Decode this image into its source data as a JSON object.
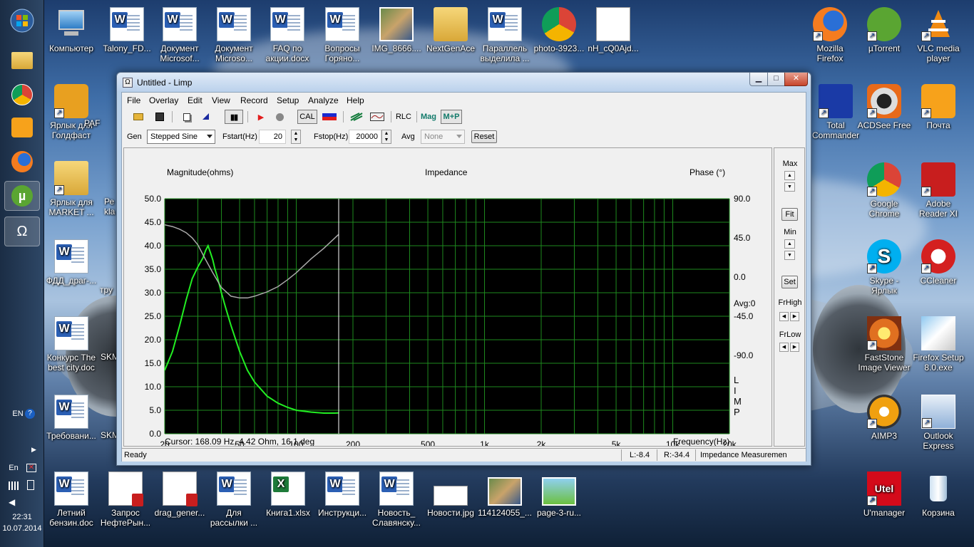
{
  "desktop": {
    "top_row": [
      {
        "label": "Компьютер",
        "kind": "computer"
      },
      {
        "label": "Talony_FD...",
        "kind": "doc"
      },
      {
        "label": "Документ Microsof...",
        "kind": "doc"
      },
      {
        "label": "Документ Microso...",
        "kind": "doc"
      },
      {
        "label": "FAQ по акции.docx",
        "kind": "doc"
      },
      {
        "label": "Вопросы Горяно...",
        "kind": "doc"
      },
      {
        "label": "IMG_8666....",
        "kind": "img"
      },
      {
        "label": "NextGenAce",
        "kind": "folder"
      },
      {
        "label": "Параллель выделила ...",
        "kind": "doc"
      },
      {
        "label": "photo-3923...",
        "kind": "chrome"
      },
      {
        "label": "nH_cQ0Ajd...",
        "kind": "img"
      }
    ],
    "left_col": [
      {
        "label": "Ярлык для Голдфаст"
      },
      {
        "label": "PAF"
      },
      {
        "label": "Ярлык для MARKET ..."
      },
      {
        "label": "Ре kla"
      },
      {
        "label": "ФДД_драг-..."
      },
      {
        "label": "тру"
      },
      {
        "label": "Конкурс The best city.doc"
      },
      {
        "label": "SKM"
      },
      {
        "label": "Требовани..."
      },
      {
        "label": "SKM"
      }
    ],
    "right_col": [
      {
        "label": "Mozilla Firefox"
      },
      {
        "label": "µTorrent"
      },
      {
        "label": "VLC media player"
      },
      {
        "label": "Total Commander"
      },
      {
        "label": "ACDSee Free"
      },
      {
        "label": "Почта"
      },
      {
        "label": "Google Chrome"
      },
      {
        "label": "Adobe Reader XI"
      },
      {
        "label": "Skype - Ярлык"
      },
      {
        "label": "CCleaner"
      },
      {
        "label": "FastStone Image Viewer"
      },
      {
        "label": "Firefox Setup 8.0.exe"
      },
      {
        "label": "AIMP3"
      },
      {
        "label": "Outlook Express"
      },
      {
        "label": "U'manager"
      },
      {
        "label": "Корзина"
      }
    ],
    "bottom_row": [
      {
        "label": "Летний бензин.doc"
      },
      {
        "label": "Запрос НефтеРын..."
      },
      {
        "label": "drag_gener..."
      },
      {
        "label": "Для рассылки ..."
      },
      {
        "label": "Книга1.xlsx"
      },
      {
        "label": "Инструкци..."
      },
      {
        "label": "Новость_ Славянску..."
      },
      {
        "label": "Новости.jpg"
      },
      {
        "label": "114124055_..."
      },
      {
        "label": "page-3-ru..."
      }
    ],
    "utel_badge": "Utel"
  },
  "taskbar": {
    "lang": "EN",
    "lang2": "En",
    "time": "22:31",
    "date": "10.07.2014",
    "app_symbol": "Ω"
  },
  "window": {
    "title": "Untitled - Limp",
    "menu": [
      "File",
      "Overlay",
      "Edit",
      "View",
      "Record",
      "Setup",
      "Analyze",
      "Help"
    ],
    "toolbar": {
      "cal": "CAL",
      "rlc": "RLC",
      "mag": "Mag",
      "mp": "M+P"
    },
    "controls": {
      "gen_label": "Gen",
      "gen_value": "Stepped Sine",
      "fstart_label": "Fstart(Hz)",
      "fstart_value": "20",
      "fstop_label": "Fstop(Hz)",
      "fstop_value": "20000",
      "avg_label": "Avg",
      "avg_value": "None",
      "reset_label": "Reset"
    },
    "side": {
      "max": "Max",
      "fit": "Fit",
      "min": "Min",
      "set": "Set",
      "frhigh": "FrHigh",
      "frlow": "FrLow"
    },
    "status": {
      "ready": "Ready",
      "left": "L:-8.4",
      "right": "R:-34.4",
      "mode": "Impedance Measuremen"
    }
  },
  "chart_data": {
    "type": "line",
    "title": "Impedance",
    "ylabel_left": "Magnitude(ohms)",
    "ylabel_right": "Phase (°)",
    "xlabel": "Frequency(Hz)",
    "x_scale": "log",
    "xlim": [
      20,
      20000
    ],
    "ylim_left": [
      0,
      50
    ],
    "ylim_right": [
      -180,
      90
    ],
    "x_ticks": [
      "20",
      "50",
      "100",
      "200",
      "500",
      "1k",
      "2k",
      "5k",
      "10k",
      "20k"
    ],
    "y_ticks_left": [
      "50.0",
      "45.0",
      "40.0",
      "35.0",
      "30.0",
      "25.0",
      "20.0",
      "15.0",
      "10.0",
      "5.0",
      "0.0"
    ],
    "y_ticks_right": [
      "90.0",
      "45.0",
      "0.0",
      "-45.0",
      "-90.0"
    ],
    "avg_text": "Avg:0",
    "brand": [
      "L",
      "I",
      "M",
      "P"
    ],
    "cursor_text": "Cursor: 168.09 Hz, 4.42 Ohm, 16.1 deg",
    "background": "#000000",
    "grid_color": "#1e8a1e",
    "series": [
      {
        "name": "Magnitude",
        "color": "#22ee22",
        "axis": "left",
        "x": [
          20,
          22,
          24,
          26,
          28,
          30,
          32,
          33,
          34,
          35,
          36,
          37,
          38,
          40,
          42,
          45,
          50,
          55,
          60,
          70,
          80,
          90,
          100,
          120,
          140,
          160,
          168
        ],
        "y": [
          13.5,
          17.5,
          23,
          28.5,
          33,
          35.5,
          37.5,
          39,
          40,
          38.5,
          37,
          35,
          33.5,
          30,
          27,
          23,
          17.5,
          13.5,
          11,
          8,
          6.5,
          5.6,
          5,
          4.6,
          4.4,
          4.4,
          4.42
        ]
      },
      {
        "name": "Phase",
        "color": "#aaaaaa",
        "axis": "right",
        "x": [
          20,
          22,
          24,
          26,
          28,
          30,
          33,
          36,
          40,
          45,
          50,
          55,
          60,
          70,
          80,
          90,
          100,
          120,
          140,
          168
        ],
        "y": [
          60,
          58,
          55,
          51,
          45,
          37,
          20,
          5,
          -12,
          -22,
          -24,
          -24,
          -22,
          -17,
          -11,
          -3,
          5,
          21,
          33,
          49
        ]
      }
    ]
  }
}
